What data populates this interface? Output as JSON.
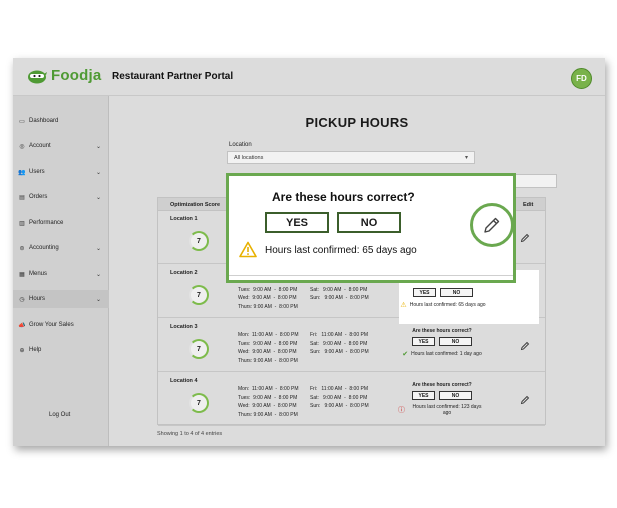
{
  "app": {
    "brand": "Foodja",
    "portal_title": "Restaurant Partner Portal",
    "user_initials": "FD"
  },
  "sidebar": {
    "items": [
      {
        "label": "Dashboard",
        "icon": "dashboard-icon",
        "chevron": false
      },
      {
        "label": "Account",
        "icon": "account-icon",
        "chevron": true
      },
      {
        "label": "Users",
        "icon": "users-icon",
        "chevron": true
      },
      {
        "label": "Orders",
        "icon": "orders-icon",
        "chevron": true
      },
      {
        "label": "Performance",
        "icon": "performance-icon",
        "chevron": false
      },
      {
        "label": "Accounting",
        "icon": "accounting-icon",
        "chevron": true
      },
      {
        "label": "Menus",
        "icon": "menus-icon",
        "chevron": true
      },
      {
        "label": "Hours",
        "icon": "clock-icon",
        "chevron": true,
        "active": true
      },
      {
        "label": "Grow Your Sales",
        "icon": "megaphone-icon",
        "chevron": false
      },
      {
        "label": "Help",
        "icon": "help-icon",
        "chevron": false
      }
    ],
    "logout": "Log Out"
  },
  "page": {
    "title": "PICKUP HOURS",
    "location_label": "Location",
    "location_value": "All locations"
  },
  "table": {
    "col_optimization": "Optimization Score",
    "col_edit": "Edit",
    "rows": [
      {
        "name": "Location 1",
        "score": "7",
        "hours": "",
        "question": "",
        "yes": "",
        "no": "",
        "status": ""
      },
      {
        "name": "Location 2",
        "score": "7",
        "hours_left": "Mon:  11:00 AM  -  8:00 PM\nTues:  9:00 AM  -  8:00 PM\nWed:  9:00 AM  -  8:00 PM\nThurs: 9:00 AM  -  8:00 PM",
        "hours_right": "Fri:   11:00 AM  -  8:00 PM\nSat:   9:00 AM  -  8:00 PM\nSun:   9:00 AM  -  8:00 PM",
        "question": "",
        "yes": "YES",
        "no": "NO",
        "status": "Hours last confirmed: 65 days ago"
      },
      {
        "name": "Location 3",
        "score": "7",
        "hours_left": "Mon:  11:00 AM  -  8:00 PM\nTues:  9:00 AM  -  8:00 PM\nWed:  9:00 AM  -  8:00 PM\nThurs: 9:00 AM  -  8:00 PM",
        "hours_right": "Fri:   11:00 AM  -  8:00 PM\nSat:   9:00 AM  -  8:00 PM\nSun:   9:00 AM  -  8:00 PM",
        "question": "Are these hours correct?",
        "yes": "YES",
        "no": "NO",
        "status": "Hours last confirmed: 1 day ago"
      },
      {
        "name": "Location 4",
        "score": "7",
        "hours_left": "Mon:  11:00 AM  -  8:00 PM\nTues:  9:00 AM  -  8:00 PM\nWed:  9:00 AM  -  8:00 PM\nThurs: 9:00 AM  -  8:00 PM",
        "hours_right": "Fri:   11:00 AM  -  8:00 PM\nSat:   9:00 AM  -  8:00 PM\nSun:   9:00 AM  -  8:00 PM",
        "question": "Are these hours correct?",
        "yes": "YES",
        "no": "NO",
        "status": "Hours last confirmed: 123 days ago"
      }
    ],
    "showing": "Showing 1 to 4 of 4 entries"
  },
  "callout": {
    "question": "Are these hours correct?",
    "yes": "YES",
    "no": "NO",
    "status": "Hours last confirmed: 65 days ago"
  },
  "colors": {
    "brand_green": "#4f9a34",
    "accent_green": "#6aa84f",
    "warning": "#e8b100",
    "success": "#4f9a34",
    "error": "#cc2222"
  }
}
